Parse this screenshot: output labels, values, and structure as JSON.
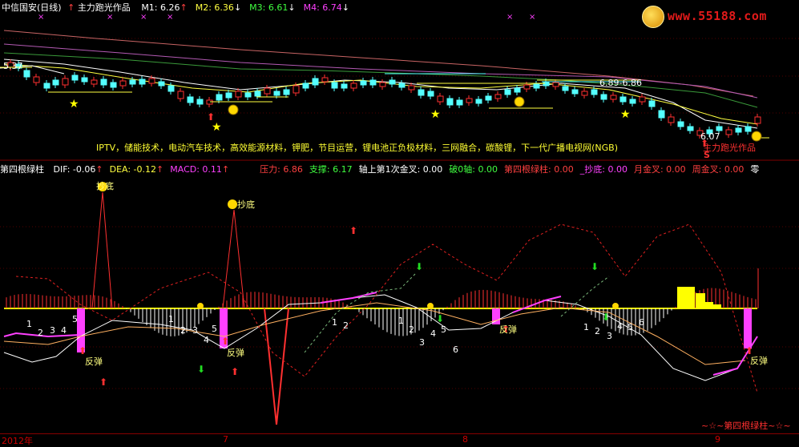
{
  "header": {
    "stock_title": "中信国安(日线)",
    "indicator_name": "主力跑光作品",
    "ma": [
      {
        "label": "M1:",
        "value": "6.26",
        "color": "#ffffff",
        "arrow": "↑",
        "arrow_color": "#ff4040"
      },
      {
        "label": "M2:",
        "value": "6.36",
        "color": "#ffff40",
        "arrow": "↓",
        "arrow_color": "#ffffff"
      },
      {
        "label": "M3:",
        "value": "6.61",
        "color": "#40ff40",
        "arrow": "↓",
        "arrow_color": "#ffffff"
      },
      {
        "label": "M4:",
        "value": "6.74",
        "color": "#ff40ff",
        "arrow": "↓",
        "arrow_color": "#ffffff"
      }
    ]
  },
  "watermark": {
    "text": "www.55188.com"
  },
  "price_panel": {
    "left_price_label": "5.37",
    "range_label": "6.89-6.86",
    "low_label": "6.07",
    "sig_s": "S",
    "author_tag": "主力跑光作品",
    "concepts": "IPTV，储能技术，电动汽车技术，高效能源材料，钾肥，节目运营，锂电池正负极材料，三网融合，碳酸锂，下一代广播电视网(NGB)"
  },
  "indicator_header": {
    "name": "第四根绿柱",
    "items": [
      {
        "label": "DIF:",
        "value": "-0.06",
        "color": "#ffffff",
        "arrow": "↑",
        "arrow_color": "#ff4040"
      },
      {
        "label": "DEA:",
        "value": "-0.12",
        "color": "#ffff40",
        "arrow": "↑",
        "arrow_color": "#ff4040"
      },
      {
        "label": "MACD:",
        "value": "0.11",
        "color": "#ff40ff",
        "arrow": "↑",
        "arrow_color": "#ff4040"
      },
      {
        "label": "压力:",
        "value": "6.86",
        "color": "#ff4040",
        "arrow": "",
        "arrow_color": ""
      },
      {
        "label": "支撑:",
        "value": "6.17",
        "color": "#40ff40",
        "arrow": "",
        "arrow_color": ""
      },
      {
        "label": "轴上第1次金叉:",
        "value": "0.00",
        "color": "#ffffff",
        "arrow": "",
        "arrow_color": ""
      },
      {
        "label": "破0轴:",
        "value": "0.00",
        "color": "#40ff40",
        "arrow": "",
        "arrow_color": ""
      },
      {
        "label": "第四根绿柱:",
        "value": "0.00",
        "color": "#ff4040",
        "arrow": "",
        "arrow_color": ""
      },
      {
        "label": "_抄底:",
        "value": "0.00",
        "color": "#ff40ff",
        "arrow": "",
        "arrow_color": ""
      },
      {
        "label": "月金叉:",
        "value": "0.00",
        "color": "#ff4040",
        "arrow": "",
        "arrow_color": ""
      },
      {
        "label": "周金叉:",
        "value": "0.00",
        "color": "#ff4040",
        "arrow": "",
        "arrow_color": ""
      },
      {
        "label": "零",
        "value": "",
        "color": "#ffffff",
        "arrow": "",
        "arrow_color": ""
      }
    ]
  },
  "annotations": {
    "chaodi": "抄底",
    "fantan": "反弹",
    "footer_tag": "~☆~第四根绿柱~☆~",
    "count_seq": [
      "1",
      "2",
      "3",
      "4",
      "5",
      "6"
    ]
  },
  "axis": {
    "dates": [
      "2012年",
      "7",
      "8",
      "9"
    ]
  },
  "colors": {
    "background": "#000000",
    "up_candle": "#ff3030",
    "down_candle": "#54ffff",
    "zero_line": "#ffff00",
    "hist_pos": "#ff3030",
    "hist_neg": "#ffffff",
    "magenta_bar": "#ff40ff",
    "yellow_block": "#ffff00"
  }
}
